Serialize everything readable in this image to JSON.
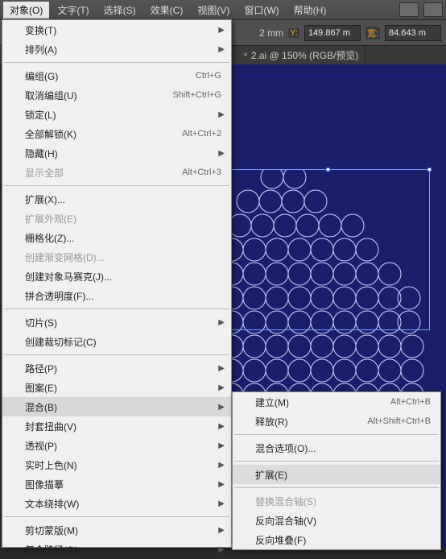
{
  "menubar": {
    "items": [
      "对象(O)",
      "文字(T)",
      "选择(S)",
      "效果(C)",
      "视图(V)",
      "窗口(W)",
      "帮助(H)"
    ]
  },
  "toolbar": {
    "x_suffix": "2 mm",
    "y_label": "Y:",
    "y_value": "149.867 m",
    "w_label": "宽:",
    "w_value": "84.643 m"
  },
  "tab": {
    "label": "2.ai @ 150% (RGB/预览)"
  },
  "mainmenu": [
    {
      "label": "变换(T)",
      "arrow": true
    },
    {
      "label": "排列(A)",
      "arrow": true
    },
    {
      "sep": true
    },
    {
      "label": "编组(G)",
      "shortcut": "Ctrl+G"
    },
    {
      "label": "取消编组(U)",
      "shortcut": "Shift+Ctrl+G"
    },
    {
      "label": "锁定(L)",
      "arrow": true
    },
    {
      "label": "全部解锁(K)",
      "shortcut": "Alt+Ctrl+2"
    },
    {
      "label": "隐藏(H)",
      "arrow": true
    },
    {
      "label": "显示全部",
      "shortcut": "Alt+Ctrl+3",
      "disabled": true
    },
    {
      "sep": true
    },
    {
      "label": "扩展(X)..."
    },
    {
      "label": "扩展外观(E)",
      "disabled": true
    },
    {
      "label": "栅格化(Z)..."
    },
    {
      "label": "创建渐变网格(D)...",
      "disabled": true
    },
    {
      "label": "创建对象马赛克(J)..."
    },
    {
      "label": "拼合透明度(F)..."
    },
    {
      "sep": true
    },
    {
      "label": "切片(S)",
      "arrow": true
    },
    {
      "label": "创建裁切标记(C)"
    },
    {
      "sep": true
    },
    {
      "label": "路径(P)",
      "arrow": true
    },
    {
      "label": "图案(E)",
      "arrow": true
    },
    {
      "label": "混合(B)",
      "arrow": true,
      "hover": true
    },
    {
      "label": "封套扭曲(V)",
      "arrow": true
    },
    {
      "label": "透视(P)",
      "arrow": true
    },
    {
      "label": "实时上色(N)",
      "arrow": true
    },
    {
      "label": "图像描摹",
      "arrow": true
    },
    {
      "label": "文本绕排(W)",
      "arrow": true
    },
    {
      "sep": true
    },
    {
      "label": "剪切蒙版(M)",
      "arrow": true
    },
    {
      "label": "复合路径(O)",
      "arrow": true
    }
  ],
  "submenu": [
    {
      "label": "建立(M)",
      "shortcut": "Alt+Ctrl+B"
    },
    {
      "label": "释放(R)",
      "shortcut": "Alt+Shift+Ctrl+B"
    },
    {
      "sep": true
    },
    {
      "label": "混合选项(O)..."
    },
    {
      "sep": true
    },
    {
      "label": "扩展(E)",
      "hover": true
    },
    {
      "sep": true
    },
    {
      "label": "替换混合轴(S)",
      "disabled": true
    },
    {
      "label": "反向混合轴(V)"
    },
    {
      "label": "反向堆叠(F)"
    }
  ]
}
